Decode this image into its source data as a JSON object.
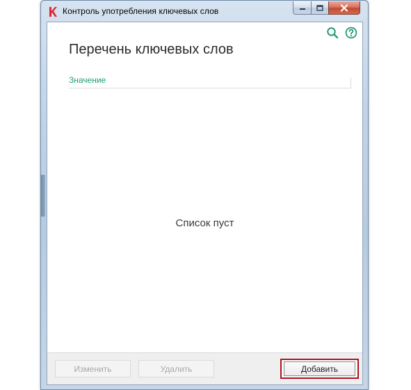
{
  "window": {
    "title": "Контроль употребления ключевых слов",
    "logo_icon": "kaspersky-k-icon",
    "controls": {
      "minimize_icon": "minimize-icon",
      "maximize_icon": "maximize-icon",
      "close_icon": "close-icon"
    }
  },
  "toolbar": {
    "search_icon": "search-icon",
    "help_icon": "help-icon",
    "accent_color": "#1f9b78"
  },
  "main": {
    "title": "Перечень ключевых слов",
    "column_header": "Значение",
    "empty_message": "Список пуст"
  },
  "footer": {
    "edit_label": "Изменить",
    "delete_label": "Удалить",
    "add_label": "Добавить",
    "highlight_color": "#b01020"
  }
}
